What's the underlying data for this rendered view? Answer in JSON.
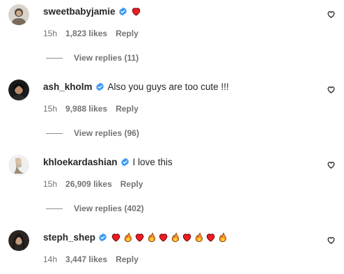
{
  "colors": {
    "verified": "#3897f0",
    "heart_red": "#ed1c24",
    "secondary_text": "#737373",
    "primary_text": "#262626"
  },
  "comments": [
    {
      "username": "sweetbabyjamie",
      "text": "",
      "emojis": [
        "heart"
      ],
      "time": "15h",
      "likes": "1,823 likes",
      "reply": "Reply",
      "view_replies": "View replies (11)"
    },
    {
      "username": "ash_kholm",
      "text": "Also you guys are too cute !!!",
      "emojis": [],
      "time": "15h",
      "likes": "9,988 likes",
      "reply": "Reply",
      "view_replies": "View replies (96)"
    },
    {
      "username": "khloekardashian",
      "text": "I love this",
      "emojis": [],
      "time": "15h",
      "likes": "26,909 likes",
      "reply": "Reply",
      "view_replies": "View replies (402)"
    },
    {
      "username": "steph_shep",
      "text": "",
      "emojis": [
        "heart",
        "fire",
        "heart",
        "fire",
        "heart",
        "fire",
        "heart",
        "fire",
        "heart",
        "fire"
      ],
      "time": "14h",
      "likes": "3,447 likes",
      "reply": "Reply",
      "view_replies": ""
    }
  ]
}
